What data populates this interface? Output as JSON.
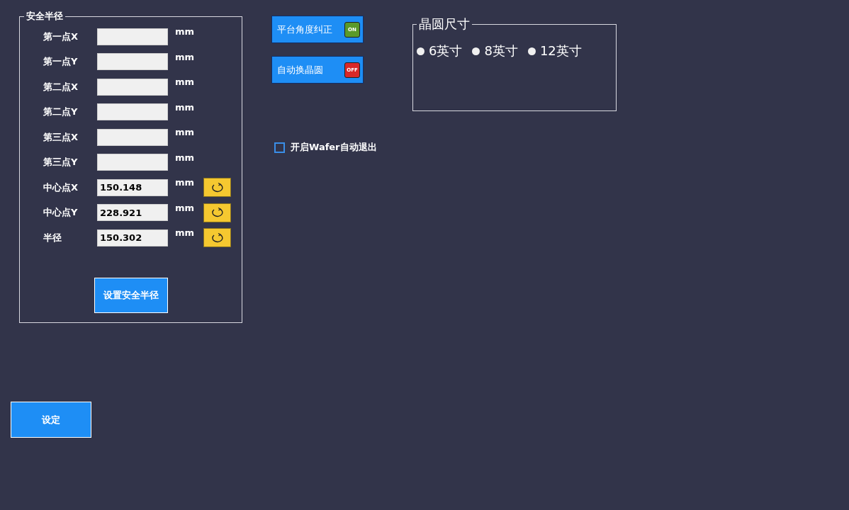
{
  "safe_radius": {
    "title": "安全半径",
    "fields": [
      {
        "label": "第一点X",
        "unit": "mm",
        "refresh": false
      },
      {
        "label": "第一点Y",
        "unit": "mm",
        "refresh": false
      },
      {
        "label": "第二点X",
        "unit": "mm",
        "refresh": false
      },
      {
        "label": "第二点Y",
        "unit": "mm",
        "refresh": false
      },
      {
        "label": "第三点X",
        "unit": "mm",
        "refresh": false
      },
      {
        "label": "第三点Y",
        "unit": "mm",
        "refresh": false
      },
      {
        "label": "中心点X",
        "value": "150.148",
        "unit": "mm",
        "refresh": true
      },
      {
        "label": "中心点Y",
        "value": "228.921",
        "unit": "mm",
        "refresh": true
      },
      {
        "label": "半径",
        "value": "150.302",
        "unit": "mm",
        "refresh": true
      }
    ],
    "button": "设置安全半径"
  },
  "set_button": "设定",
  "toggles": [
    {
      "label": "平台角度纠正",
      "on": true,
      "badge": "ON"
    },
    {
      "label": "自动换晶圆",
      "on": false,
      "badge": "OFF"
    }
  ],
  "checkbox": {
    "label": "开启Wafer自动退出",
    "checked": false
  },
  "wafer_size": {
    "title": "晶圆尺寸",
    "options": [
      {
        "label": "6英寸",
        "selected": false
      },
      {
        "label": "8英寸",
        "selected": false
      },
      {
        "label": "12英寸",
        "selected": false
      }
    ]
  }
}
